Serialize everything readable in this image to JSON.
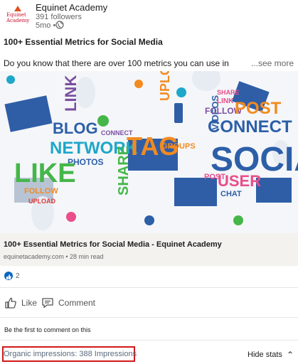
{
  "post_header": {
    "logo_text_line1": "Equinet",
    "logo_text_line2": "Academy",
    "org_name": "Equinet Academy",
    "followers": "391 followers",
    "time_ago": "5mo •",
    "visibility_icon": "globe-icon"
  },
  "post": {
    "title": "100+ Essential Metrics for Social Media",
    "body_preview": "Do you know that there are over 100 metrics you can use in",
    "see_more": "...see more"
  },
  "hero_image": {
    "words": [
      "LINK",
      "BLOG",
      "NETWORK",
      "PHOTOS",
      "LIKE",
      "FOLLOW",
      "UPLOAD",
      "SHARE",
      "CONNECT",
      "TAG",
      "UPLOAD",
      "GROUPS",
      "VIDEOS",
      "CONNECT",
      "SHARE",
      "LINK",
      "POST",
      "FOLLOW",
      "SOCIAL",
      "POST",
      "USER",
      "CHAT"
    ],
    "colors": {
      "blue": "#2d5fa8",
      "green": "#45b649",
      "orange": "#f28b20",
      "pink": "#e94e8a",
      "purple": "#7b4fa0",
      "red": "#e53935",
      "teal": "#1fa7c9"
    }
  },
  "link_card": {
    "title": "100+ Essential Metrics for Social Media - Equinet Academy",
    "domain_and_time": "equinetacademy.com • 28 min read"
  },
  "reactions": {
    "icon": "like-reaction-icon",
    "count": "2"
  },
  "actions": {
    "like_label": "Like",
    "comment_label": "Comment"
  },
  "comments": {
    "first_comment_prompt": "Be the first to comment on this"
  },
  "stats": {
    "impressions_label": "Organic impressions: 388 Impressions",
    "hide_stats_label": "Hide stats",
    "highlight_color": "#d11a1a"
  }
}
